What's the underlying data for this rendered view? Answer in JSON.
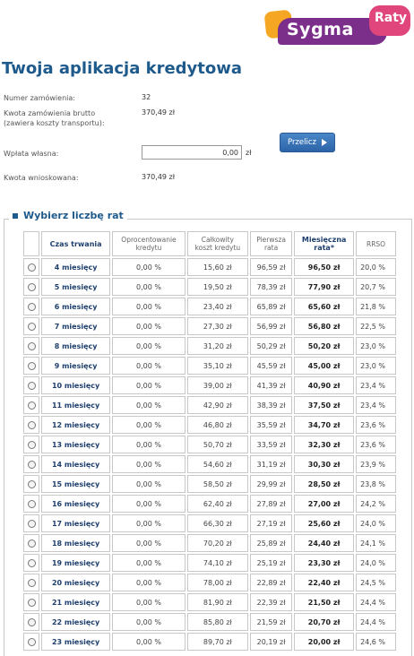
{
  "logo": {
    "brand": "Sygma",
    "badge": "Raty",
    "colors": {
      "orange": "#f5a623",
      "purple": "#7b2f8a",
      "pink": "#e0457b"
    }
  },
  "title": "Twoja aplikacja kredytowa",
  "order": {
    "number_label": "Numer zamówienia:",
    "number_value": "32",
    "amount_label_line1": "Kwota zamówienia brutto",
    "amount_label_line2": "(zawiera koszty transportu):",
    "amount_value": "370,49 zł",
    "deposit_label": "Wpłata własna:",
    "deposit_value": "0,00",
    "deposit_currency": "zł",
    "requested_label": "Kwota wnioskowana:",
    "requested_value": "370,49 zł"
  },
  "recalc_button": {
    "label": "Przelicz",
    "icon": "play-arrow-icon"
  },
  "rates_section": {
    "legend": "Wybierz liczbę rat",
    "headers": {
      "duration": "Czas trwania",
      "interest_line1": "Oprocentowanie",
      "interest_line2": "kredytu",
      "cost_line1": "Całkowity",
      "cost_line2": "koszt kredytu",
      "first_line1": "Pierwsza",
      "first_line2": "rata",
      "monthly_line1": "Miesięczna",
      "monthly_line2": "rata*",
      "rrso": "RRSO"
    },
    "rows": [
      {
        "duration": "4 miesięcy",
        "interest": "0,00 %",
        "cost": "15,60 zł",
        "first": "96,59 zł",
        "monthly": "96,50 zł",
        "rrso": "20,0 %"
      },
      {
        "duration": "5 miesięcy",
        "interest": "0,00 %",
        "cost": "19,50 zł",
        "first": "78,39 zł",
        "monthly": "77,90 zł",
        "rrso": "20,7 %"
      },
      {
        "duration": "6 miesięcy",
        "interest": "0,00 %",
        "cost": "23,40 zł",
        "first": "65,89 zł",
        "monthly": "65,60 zł",
        "rrso": "21,8 %"
      },
      {
        "duration": "7 miesięcy",
        "interest": "0,00 %",
        "cost": "27,30 zł",
        "first": "56,99 zł",
        "monthly": "56,80 zł",
        "rrso": "22,5 %"
      },
      {
        "duration": "8 miesięcy",
        "interest": "0,00 %",
        "cost": "31,20 zł",
        "first": "50,29 zł",
        "monthly": "50,20 zł",
        "rrso": "23,0 %"
      },
      {
        "duration": "9 miesięcy",
        "interest": "0,00 %",
        "cost": "35,10 zł",
        "first": "45,59 zł",
        "monthly": "45,00 zł",
        "rrso": "23,0 %"
      },
      {
        "duration": "10 miesięcy",
        "interest": "0,00 %",
        "cost": "39,00 zł",
        "first": "41,39 zł",
        "monthly": "40,90 zł",
        "rrso": "23,4 %"
      },
      {
        "duration": "11 miesięcy",
        "interest": "0,00 %",
        "cost": "42,90 zł",
        "first": "38,39 zł",
        "monthly": "37,50 zł",
        "rrso": "23,4 %"
      },
      {
        "duration": "12 miesięcy",
        "interest": "0,00 %",
        "cost": "46,80 zł",
        "first": "35,59 zł",
        "monthly": "34,70 zł",
        "rrso": "23,6 %"
      },
      {
        "duration": "13 miesięcy",
        "interest": "0,00 %",
        "cost": "50,70 zł",
        "first": "33,59 zł",
        "monthly": "32,30 zł",
        "rrso": "23,6 %"
      },
      {
        "duration": "14 miesięcy",
        "interest": "0,00 %",
        "cost": "54,60 zł",
        "first": "31,19 zł",
        "monthly": "30,30 zł",
        "rrso": "23,9 %"
      },
      {
        "duration": "15 miesięcy",
        "interest": "0,00 %",
        "cost": "58,50 zł",
        "first": "29,99 zł",
        "monthly": "28,50 zł",
        "rrso": "23,8 %"
      },
      {
        "duration": "16 miesięcy",
        "interest": "0,00 %",
        "cost": "62,40 zł",
        "first": "27,89 zł",
        "monthly": "27,00 zł",
        "rrso": "24,2 %"
      },
      {
        "duration": "17 miesięcy",
        "interest": "0,00 %",
        "cost": "66,30 zł",
        "first": "27,19 zł",
        "monthly": "25,60 zł",
        "rrso": "24,0 %"
      },
      {
        "duration": "18 miesięcy",
        "interest": "0,00 %",
        "cost": "70,20 zł",
        "first": "25,89 zł",
        "monthly": "24,40 zł",
        "rrso": "24,1 %"
      },
      {
        "duration": "19 miesięcy",
        "interest": "0,00 %",
        "cost": "74,10 zł",
        "first": "25,19 zł",
        "monthly": "23,30 zł",
        "rrso": "24,0 %"
      },
      {
        "duration": "20 miesięcy",
        "interest": "0,00 %",
        "cost": "78,00 zł",
        "first": "22,89 zł",
        "monthly": "22,40 zł",
        "rrso": "24,5 %"
      },
      {
        "duration": "21 miesięcy",
        "interest": "0,00 %",
        "cost": "81,90 zł",
        "first": "22,39 zł",
        "monthly": "21,50 zł",
        "rrso": "24,4 %"
      },
      {
        "duration": "22 miesięcy",
        "interest": "0,00 %",
        "cost": "85,80 zł",
        "first": "21,59 zł",
        "monthly": "20,70 zł",
        "rrso": "24,4 %"
      },
      {
        "duration": "23 miesięcy",
        "interest": "0,00 %",
        "cost": "89,70 zł",
        "first": "20,19 zł",
        "monthly": "20,00 zł",
        "rrso": "24,6 %"
      }
    ]
  }
}
